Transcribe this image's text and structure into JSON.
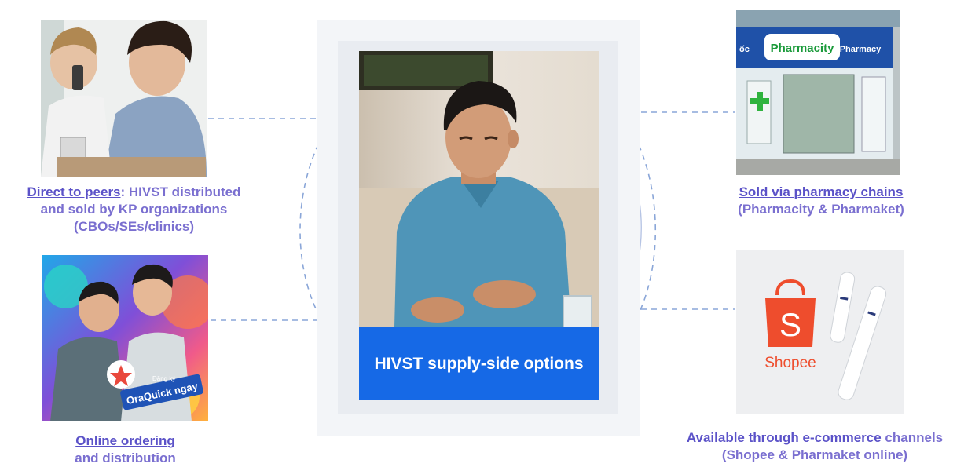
{
  "center": {
    "banner_text": "HIVST supply-side options"
  },
  "options": [
    {
      "id": "peers",
      "link_text": "Direct to peers",
      "rest_line1": ": HIVST distributed",
      "line2": "and sold by KP organizations",
      "line3": "(CBOs/SEs/clinics)"
    },
    {
      "id": "online",
      "link_line1": "Online ordering",
      "line2": "and distribution",
      "promo": {
        "small_text": "Đăng ký",
        "cta_text": "OraQuick ngay"
      }
    },
    {
      "id": "pharmacy",
      "link_line1": "Sold via pharmacy chains",
      "line2": "(Pharmacity & Pharmaket)",
      "sign": {
        "brand": "Pharmacity",
        "side_text": "Pharmacy",
        "left_text": "ốc"
      }
    },
    {
      "id": "ecommerce",
      "link_text": "Available through e-commerce ",
      "rest_line1": "channels",
      "line2": "(Shopee & Pharmaket online)",
      "shopee": {
        "bag_letter": "S",
        "wordmark": "Shopee"
      }
    }
  ],
  "colors": {
    "banner": "#1669e6",
    "caption": "#7a6fd0",
    "dashed": "#7f9bd0",
    "shopee": "#ee4d2d"
  }
}
